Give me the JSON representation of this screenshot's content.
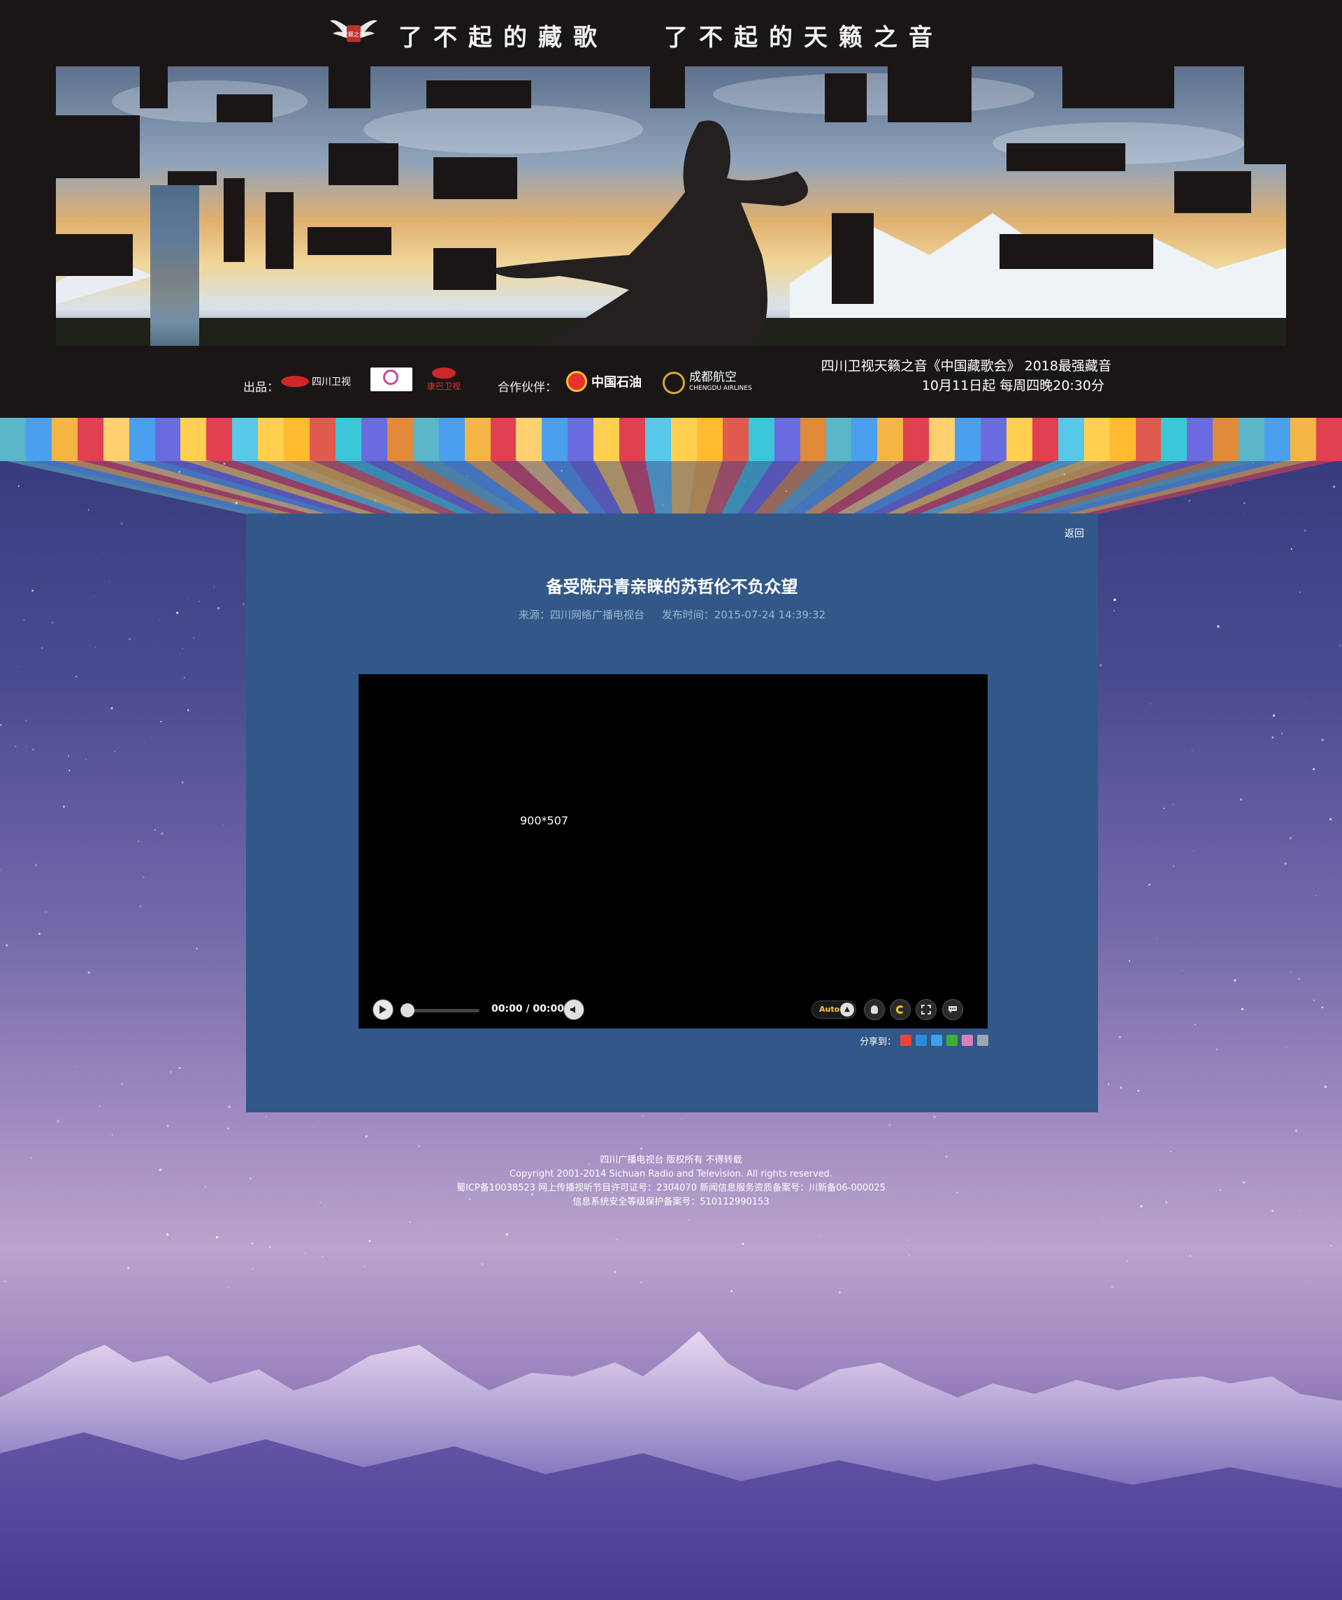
{
  "header": {
    "slogan_left": "了不起的藏歌",
    "slogan_right": "了不起的天籁之音",
    "logo_text": "天籁之音",
    "producer_label": "出品：",
    "producer_logos": [
      "四川卫视",
      "",
      "康巴卫视"
    ],
    "partner_label": "合作伙伴：",
    "partner_logos": [
      "中国石油",
      "成都航空"
    ],
    "partner_sub": "CHENGDU AIRLINES",
    "tv_line1": "四川卫视天籁之音《中国藏歌会》  2018最强藏音",
    "tv_line2": "10月11日起    每周四晚20:30分"
  },
  "article": {
    "back_label": "返回",
    "title": "备受陈丹青亲睐的苏哲伦不负众望",
    "source": "来源：四川网络广播电视台",
    "published": "发布时间：2015-07-24 14:39:32"
  },
  "player": {
    "size_label": "900*507",
    "time": "00:00 / 00:00",
    "quality": "Auto",
    "share_label": "分享到："
  },
  "footer": {
    "line1": "四川广播电视台 版权所有 不得转载",
    "line2": "Copyright 2001-2014 Sichuan Radio and Television. All rights reserved.",
    "line3": "蜀ICP备10038523    网上传播视听节目许可证号：2304070 新闻信息服务资质备案号：川新备06-000025",
    "line4": "信息系统安全等级保护备案号：510112990153"
  },
  "colors": {
    "card_bg": "#315888",
    "header_bg": "#1b1616",
    "stripe": [
      "#5ab6c8",
      "#4aa0ee",
      "#f5b545",
      "#e04050",
      "#ffcf70",
      "#4aa0ee",
      "#6b6be0",
      "#ffd050",
      "#e04050",
      "#57c8e8",
      "#ffd050",
      "#ffba30",
      "#e05a50",
      "#3ac8d8",
      "#6b6be0",
      "#e08a3a"
    ]
  }
}
